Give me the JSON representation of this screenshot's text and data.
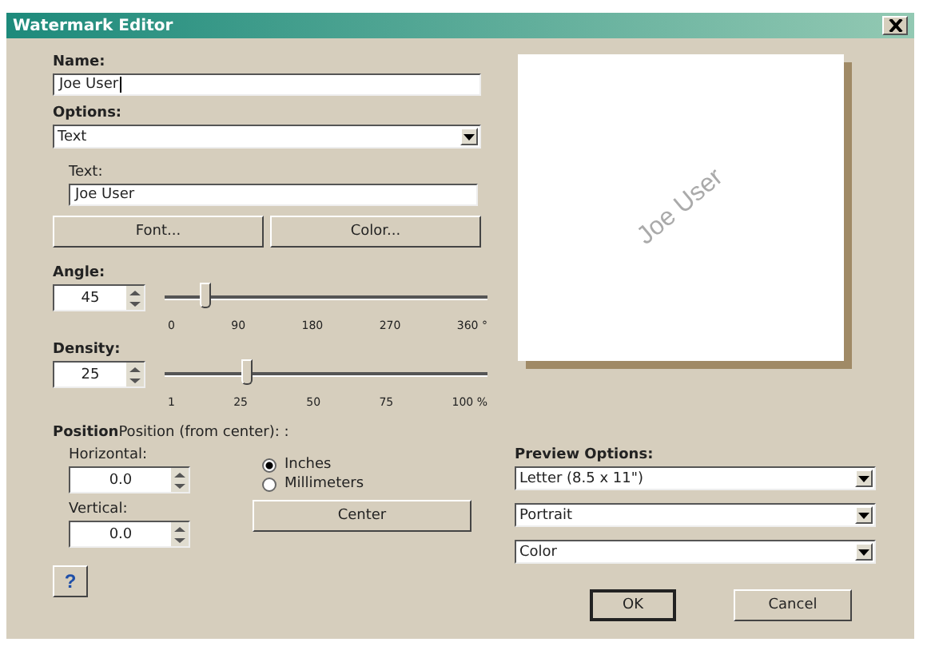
{
  "window": {
    "title": "Watermark Editor"
  },
  "name": {
    "label": "Name:",
    "value": "Joe User"
  },
  "options": {
    "label": "Options:",
    "value": "Text"
  },
  "text": {
    "label": "Text:",
    "value": "Joe User"
  },
  "font_button": "Font...",
  "color_button": "Color...",
  "sliders": [
    {
      "label": "Angle:",
      "value": "45",
      "level": 0.125,
      "ticks": [
        "0",
        "90",
        "180",
        "270",
        "360 °"
      ]
    },
    {
      "label": "Density:",
      "value": "25",
      "level": 0.25,
      "ticks": [
        "1",
        "25",
        "50",
        "75",
        "100 %"
      ]
    }
  ],
  "position": {
    "title": "**Position**Position (from center): :",
    "fields": [
      {
        "label": "Horizontal:",
        "value": "0.0"
      },
      {
        "label": "Vertical:",
        "value": "0.0"
      }
    ],
    "units": [
      {
        "label": "Inches",
        "selected": true
      },
      {
        "label": "Millimeters",
        "selected": false
      }
    ],
    "center_button": "Center"
  },
  "preview": {
    "watermark": "Joe User"
  },
  "preview_options": {
    "label": "Preview Options:",
    "selects": [
      "Letter (8.5 x 11\")",
      "Portrait",
      "Color"
    ]
  },
  "help_button": "?",
  "ok_button": "OK",
  "cancel_button": "Cancel"
}
